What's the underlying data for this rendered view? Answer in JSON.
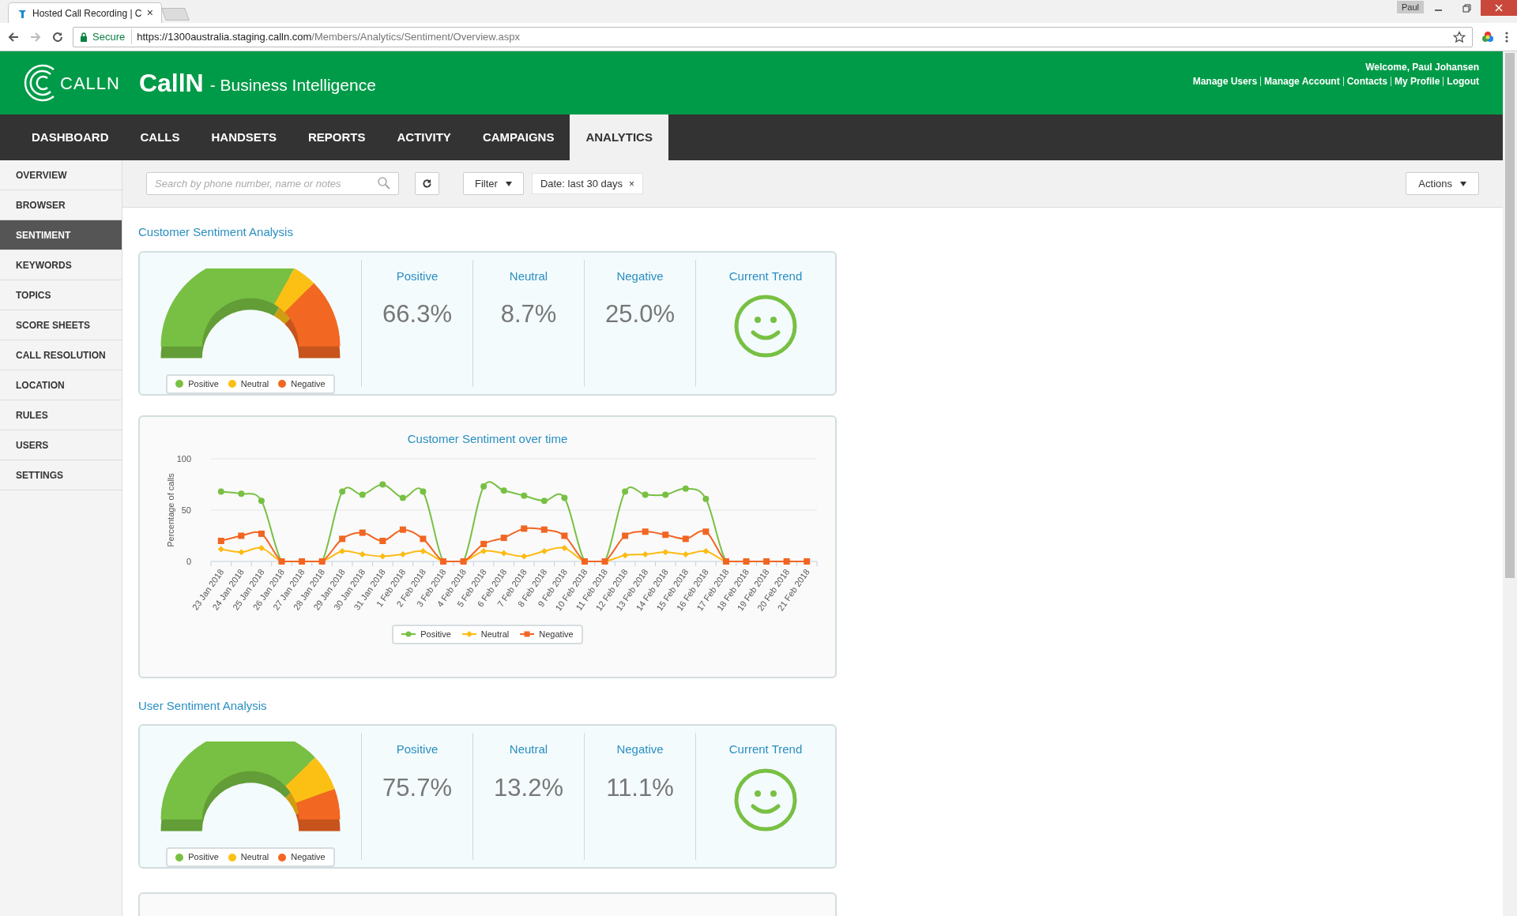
{
  "browser": {
    "tab_title": "Hosted Call Recording | C",
    "tab_close": "×",
    "profile": "Paul",
    "secure": "Secure",
    "url_host": "https://1300australia.staging.calln.com",
    "url_path": "/Members/Analytics/Sentiment/Overview.aspx"
  },
  "header": {
    "logo_text": "CALLN",
    "title": "CallN",
    "subtitle": "- Business Intelligence",
    "welcome": "Welcome, Paul Johansen",
    "links": [
      "Manage Users",
      "Manage Account",
      "Contacts",
      "My Profile",
      "Logout"
    ]
  },
  "nav": [
    {
      "label": "DASHBOARD",
      "selected": false
    },
    {
      "label": "CALLS",
      "selected": false
    },
    {
      "label": "HANDSETS",
      "selected": false
    },
    {
      "label": "REPORTS",
      "selected": false
    },
    {
      "label": "ACTIVITY",
      "selected": false
    },
    {
      "label": "CAMPAIGNS",
      "selected": false
    },
    {
      "label": "ANALYTICS",
      "selected": true
    }
  ],
  "sidebar": [
    {
      "label": "OVERVIEW",
      "selected": false
    },
    {
      "label": "BROWSER",
      "selected": false
    },
    {
      "label": "SENTIMENT",
      "selected": true
    },
    {
      "label": "KEYWORDS",
      "selected": false
    },
    {
      "label": "TOPICS",
      "selected": false
    },
    {
      "label": "SCORE SHEETS",
      "selected": false
    },
    {
      "label": "CALL RESOLUTION",
      "selected": false
    },
    {
      "label": "LOCATION",
      "selected": false
    },
    {
      "label": "RULES",
      "selected": false
    },
    {
      "label": "USERS",
      "selected": false
    },
    {
      "label": "SETTINGS",
      "selected": false
    }
  ],
  "toolbar": {
    "search_placeholder": "Search by phone number, name or notes",
    "filter": "Filter",
    "date_tag": "Date: last 30 days",
    "date_tag_remove": "×",
    "actions": "Actions"
  },
  "customer_sentiment": {
    "title": "Customer Sentiment Analysis",
    "gauge": {
      "legend": [
        {
          "label": "Positive",
          "color": "#78c043"
        },
        {
          "label": "Neutral",
          "color": "#fcc015"
        },
        {
          "label": "Negative",
          "color": "#f26722"
        }
      ]
    },
    "stats": [
      {
        "label": "Positive",
        "value": "66.3%"
      },
      {
        "label": "Neutral",
        "value": "8.7%"
      },
      {
        "label": "Negative",
        "value": "25.0%"
      }
    ],
    "trend": {
      "label": "Current Trend"
    }
  },
  "customer_over_time": {
    "chart_data": {
      "type": "line",
      "legend": "bottom",
      "title": "Customer Sentiment over time",
      "ylabel": "Percentage of calls",
      "ylim": [
        0,
        100
      ],
      "yticks": [
        0,
        50,
        100
      ],
      "categories": [
        "23 Jan 2018",
        "24 Jan 2018",
        "25 Jan 2018",
        "26 Jan 2018",
        "27 Jan 2018",
        "28 Jan 2018",
        "29 Jan 2018",
        "30 Jan 2018",
        "31 Jan 2018",
        "1 Feb 2018",
        "2 Feb 2018",
        "3 Feb 2018",
        "4 Feb 2018",
        "5 Feb 2018",
        "6 Feb 2018",
        "7 Feb 2018",
        "8 Feb 2018",
        "9 Feb 2018",
        "10 Feb 2018",
        "11 Feb 2018",
        "12 Feb 2018",
        "13 Feb 2018",
        "14 Feb 2018",
        "15 Feb 2018",
        "16 Feb 2018",
        "17 Feb 2018",
        "18 Feb 2018",
        "19 Feb 2018",
        "20 Feb 2018",
        "21 Feb 2018"
      ],
      "series": [
        {
          "name": "Positive",
          "color": "#78c043",
          "marker": "circle",
          "values": [
            68,
            66,
            59,
            0,
            0,
            0,
            68,
            65,
            75,
            62,
            68,
            0,
            0,
            73,
            69,
            64,
            59,
            62,
            0,
            0,
            68,
            65,
            65,
            71,
            61,
            0,
            0,
            null,
            null,
            null
          ]
        },
        {
          "name": "Neutral",
          "color": "#fdbb12",
          "marker": "diamond",
          "values": [
            12,
            9,
            13,
            0,
            0,
            0,
            10,
            7,
            5,
            7,
            10,
            0,
            0,
            10,
            8,
            5,
            10,
            13,
            0,
            0,
            6,
            7,
            9,
            7,
            10,
            0,
            0,
            null,
            null,
            null
          ]
        },
        {
          "name": "Negative",
          "color": "#f26522",
          "marker": "square",
          "values": [
            20,
            25,
            27,
            0,
            0,
            0,
            22,
            28,
            20,
            31,
            22,
            0,
            0,
            17,
            23,
            32,
            31,
            25,
            0,
            0,
            25,
            29,
            26,
            22,
            29,
            0,
            0,
            0,
            0,
            0
          ]
        }
      ]
    }
  },
  "user_sentiment": {
    "title": "User Sentiment Analysis",
    "gauge": {
      "legend": [
        {
          "label": "Positive",
          "color": "#78c043"
        },
        {
          "label": "Neutral",
          "color": "#fcc015"
        },
        {
          "label": "Negative",
          "color": "#f26722"
        }
      ]
    },
    "stats": [
      {
        "label": "Positive",
        "value": "75.7%"
      },
      {
        "label": "Neutral",
        "value": "13.2%"
      },
      {
        "label": "Negative",
        "value": "11.1%"
      }
    ],
    "trend": {
      "label": "Current Trend"
    }
  }
}
